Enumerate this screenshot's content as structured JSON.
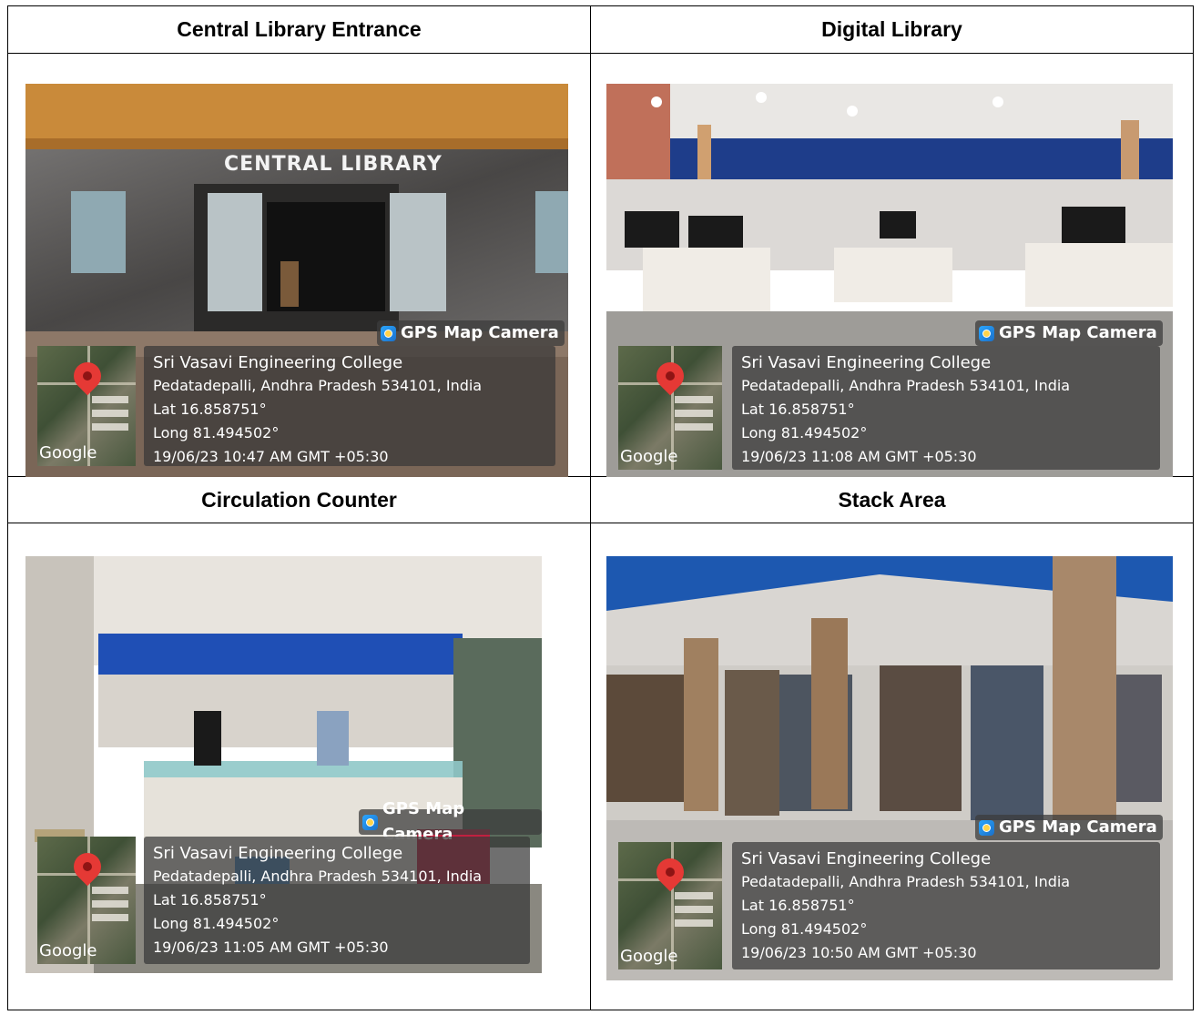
{
  "cells": [
    {
      "title": "Central Library Entrance",
      "photo": {
        "scene": "entrance",
        "sign_text": "CENTRAL LIBRARY",
        "gps_tag": "GPS Map Camera",
        "map_logo": "Google",
        "place": "Sri Vasavi Engineering College",
        "address": "Pedatadepalli, Andhra Pradesh 534101, India",
        "lat": "Lat 16.858751°",
        "long": "Long 81.494502°",
        "timestamp": "19/06/23 10:47 AM GMT +05:30"
      }
    },
    {
      "title": "Digital Library",
      "photo": {
        "scene": "computer-lab",
        "gps_tag": "GPS Map Camera",
        "map_logo": "Google",
        "place": "Sri Vasavi Engineering College",
        "address": "Pedatadepalli, Andhra Pradesh 534101, India",
        "lat": "Lat 16.858751°",
        "long": "Long 81.494502°",
        "timestamp": "19/06/23 11:08 AM GMT +05:30"
      }
    },
    {
      "title": "Circulation Counter",
      "photo": {
        "scene": "counter",
        "gps_tag": "GPS Map Camera",
        "map_logo": "Google",
        "place": "Sri Vasavi Engineering College",
        "address": "Pedatadepalli, Andhra Pradesh 534101, India",
        "lat": "Lat 16.858751°",
        "long": "Long 81.494502°",
        "timestamp": "19/06/23 11:05 AM GMT +05:30"
      }
    },
    {
      "title": "Stack Area",
      "photo": {
        "scene": "bookshelves",
        "gps_tag": "GPS Map Camera",
        "map_logo": "Google",
        "place": "Sri Vasavi Engineering College",
        "address": "Pedatadepalli, Andhra Pradesh 534101, India",
        "lat": "Lat 16.858751°",
        "long": "Long 81.494502°",
        "timestamp": "19/06/23 10:50 AM GMT +05:30"
      }
    }
  ]
}
